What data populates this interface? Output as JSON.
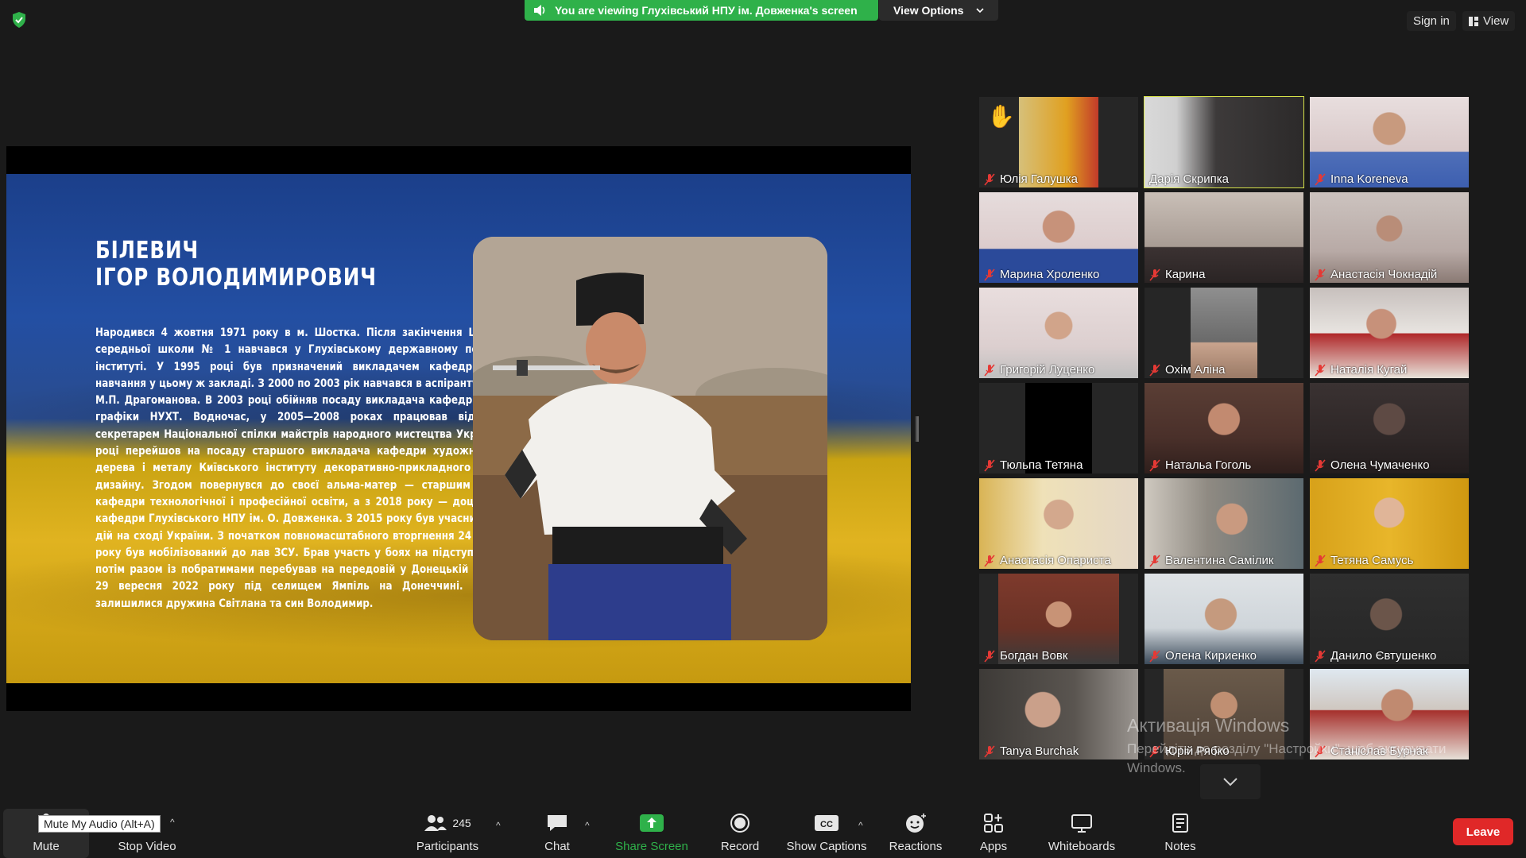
{
  "top": {
    "share_banner": "You are viewing Глухівський НПУ ім. Довженка's screen",
    "view_options": "View Options",
    "sign_in": "Sign in",
    "view": "View"
  },
  "slide": {
    "title_line1": "БІЛЕВИЧ",
    "title_line2": "ІГОР ВОЛОДИМИРОВИЧ",
    "body": "Народився 4 жовтня 1971 року в м. Шостка. Після закінчення Шосткинської середньої школи № 1 навчався у Глухівському державному педагогічному інституті. У 1995 році був призначений викладачем кафедри трудового навчання у цьому ж закладі. З 2000 по 2003 рік навчався в аспірантурі НПУ імені М.П. Драгоманова. В 2003 році обійняв посаду викладача кафедри інженерної графіки НУХТ. Водночас, у 2005—2008 роках працював відповідальним секретарем Національної спілки майстрів народного мистецтва України. У 2008 році перейшов на посаду старшого викладача кафедри художніх виробів з дерева і металу Київського інституту декоративно-прикладного мистецтва і дизайну. Згодом повернувся до своєї альма-матер — старшим викладачем кафедри технологічної і професійної освіти, а з 2018 року — доцентом цієї ж кафедри Глухівського НПУ ім. О. Довженка. З 2015 року був учасником бойових дій на сході України. З початком повномасштабного вторгнення 24 лютого 2022 року був мобілізований до лав ЗСУ. Брав участь у боях на підступах до Києва, потім разом із побратимами перебував на передовій у Донецькій обл. Загинув 29 вересня 2022 року під селищем Ямпіль на Донеччині. У загиблого залишилися дружина Світлана та син Володимир."
  },
  "participants": [
    {
      "name": "Юлія Галушка",
      "hand": "✋"
    },
    {
      "name": "Дарія Скрипка"
    },
    {
      "name": "Inna Koreneva"
    },
    {
      "name": "Марина Хроленко"
    },
    {
      "name": "Карина"
    },
    {
      "name": "Анастасія Чокнадій"
    },
    {
      "name": "Григорій Луценко"
    },
    {
      "name": "Охім Аліна"
    },
    {
      "name": "Наталія Кугай"
    },
    {
      "name": "Тюльпа Тетяна"
    },
    {
      "name": "Натальа Гоголь"
    },
    {
      "name": "Олена Чумаченко"
    },
    {
      "name": "Анастасія Опариста"
    },
    {
      "name": "Валентина Самілик"
    },
    {
      "name": "Тетяна Самусь"
    },
    {
      "name": "Богдан Вовк"
    },
    {
      "name": "Олена Кириенко"
    },
    {
      "name": "Данило Євтушенко"
    },
    {
      "name": "Tanya Burchak"
    },
    {
      "name": "Юрій Рябко"
    },
    {
      "name": "Станіслав Бурнак"
    }
  ],
  "watermark": {
    "line1": "Активація Windows",
    "line2": "Перейдіть до розділу \"Настройки\", щоб активувати",
    "line3": "Windows."
  },
  "toolbar": {
    "tooltip": "Mute My Audio (Alt+A)",
    "mute": "Mute",
    "stop_video": "Stop Video",
    "participants": "Participants",
    "participants_count": "245",
    "chat": "Chat",
    "share_screen": "Share Screen",
    "record": "Record",
    "show_captions": "Show Captions",
    "reactions": "Reactions",
    "apps": "Apps",
    "whiteboards": "Whiteboards",
    "notes": "Notes",
    "leave": "Leave"
  },
  "colors": {
    "share_green": "#2fb14a",
    "leave_red": "#e02828",
    "active_speaker": "#d6e24a",
    "muted_mic": "#e53935"
  }
}
